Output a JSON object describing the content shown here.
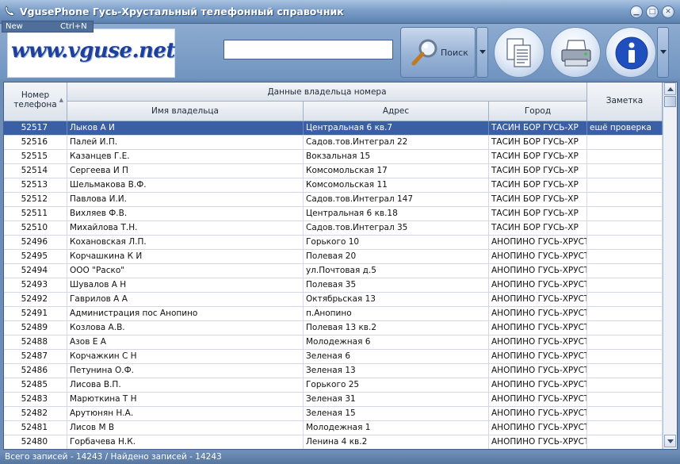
{
  "window": {
    "title": "VgusePhone Гусь-Хрустальный телефонный справочник",
    "menu_new": "New",
    "menu_new_shortcut": "Ctrl+N",
    "icon": "phone-app-icon"
  },
  "toolbar": {
    "logo_text": "www.vguse.net",
    "search_placeholder": "",
    "search_value": "",
    "search_label": "Поиск",
    "icons": [
      "magnifier-icon",
      "documents-icon",
      "printer-icon",
      "info-icon"
    ]
  },
  "grid": {
    "headers": {
      "phone": "Номер телефона",
      "owner_group": "Данные владельца номера",
      "name": "Имя владельца",
      "address": "Адрес",
      "city": "Город",
      "note": "Заметка"
    },
    "rows": [
      {
        "num": "52517",
        "name": "Лыков А И",
        "addr": "Центральная 6  кв.7",
        "city": "ТАСИН БОР ГУСЬ-ХР",
        "note": "ешё проверка",
        "selected": true
      },
      {
        "num": "52516",
        "name": "Палей И.П.",
        "addr": "Садов.тов.Интеграл 22",
        "city": "ТАСИН БОР ГУСЬ-ХР",
        "note": ""
      },
      {
        "num": "52515",
        "name": "Казанцев Г.Е.",
        "addr": "Вокзальная 15",
        "city": "ТАСИН БОР ГУСЬ-ХР",
        "note": ""
      },
      {
        "num": "52514",
        "name": "Сергеева И П",
        "addr": "Комсомольская 17",
        "city": "ТАСИН БОР ГУСЬ-ХР",
        "note": ""
      },
      {
        "num": "52513",
        "name": "Шельмакова В.Ф.",
        "addr": "Комсомольская 11",
        "city": "ТАСИН БОР ГУСЬ-ХР",
        "note": ""
      },
      {
        "num": "52512",
        "name": "Павлова И.И.",
        "addr": "Садов.тов.Интеграл 147",
        "city": "ТАСИН БОР ГУСЬ-ХР",
        "note": ""
      },
      {
        "num": "52511",
        "name": "Вихляев Ф.В.",
        "addr": "Центральная 6  кв.18",
        "city": "ТАСИН БОР ГУСЬ-ХР",
        "note": ""
      },
      {
        "num": "52510",
        "name": "Михайлова Т.Н.",
        "addr": "Садов.тов.Интеграл 35",
        "city": "ТАСИН БОР ГУСЬ-ХР",
        "note": ""
      },
      {
        "num": "52496",
        "name": "Кохановская Л.П.",
        "addr": "Горького 10",
        "city": "АНОПИНО ГУСЬ-ХРУСТ",
        "note": ""
      },
      {
        "num": "52495",
        "name": "Корчашкина К И",
        "addr": "Полевая 20",
        "city": "АНОПИНО ГУСЬ-ХРУСТ",
        "note": ""
      },
      {
        "num": "52494",
        "name": "ООО \"Раско\"",
        "addr": "ул.Почтовая д.5",
        "city": "АНОПИНО ГУСЬ-ХРУСТ",
        "note": ""
      },
      {
        "num": "52493",
        "name": "Шувалов А Н",
        "addr": "Полевая 35",
        "city": "АНОПИНО ГУСЬ-ХРУСТ",
        "note": ""
      },
      {
        "num": "52492",
        "name": "Гаврилов А А",
        "addr": "Октябрьская 13",
        "city": "АНОПИНО ГУСЬ-ХРУСТ",
        "note": ""
      },
      {
        "num": "52491",
        "name": "Администрация пос Анопино",
        "addr": "п.Анопино",
        "city": "АНОПИНО ГУСЬ-ХРУСТ",
        "note": ""
      },
      {
        "num": "52489",
        "name": "Козлова А.В.",
        "addr": "Полевая 13  кв.2",
        "city": "АНОПИНО ГУСЬ-ХРУСТ",
        "note": ""
      },
      {
        "num": "52488",
        "name": "Азов Е А",
        "addr": "Молодежная 6",
        "city": "АНОПИНО ГУСЬ-ХРУСТ",
        "note": ""
      },
      {
        "num": "52487",
        "name": "Корчажкин С Н",
        "addr": "Зеленая 6",
        "city": "АНОПИНО ГУСЬ-ХРУСТ",
        "note": ""
      },
      {
        "num": "52486",
        "name": "Петунина О.Ф.",
        "addr": "Зеленая 13",
        "city": "АНОПИНО ГУСЬ-ХРУСТ",
        "note": ""
      },
      {
        "num": "52485",
        "name": "Лисова В.П.",
        "addr": "Горького 25",
        "city": "АНОПИНО ГУСЬ-ХРУСТ",
        "note": ""
      },
      {
        "num": "52483",
        "name": "Марюткина Т Н",
        "addr": "Зеленая 31",
        "city": "АНОПИНО ГУСЬ-ХРУСТ",
        "note": ""
      },
      {
        "num": "52482",
        "name": "Арутюнян Н.А.",
        "addr": "Зеленая 15",
        "city": "АНОПИНО ГУСЬ-ХРУСТ",
        "note": ""
      },
      {
        "num": "52481",
        "name": "Лисов М В",
        "addr": "Молодежная 1",
        "city": "АНОПИНО ГУСЬ-ХРУСТ",
        "note": ""
      },
      {
        "num": "52480",
        "name": "Горбачева Н.К.",
        "addr": "Ленина 4  кв.2",
        "city": "АНОПИНО ГУСЬ-ХРУСТ",
        "note": ""
      }
    ]
  },
  "status": {
    "text": "Всего записей - 14243 / Найдено записей - 14243"
  },
  "colors": {
    "selected_row": "#3a5fa6",
    "title_bar": "#7b9ec8"
  }
}
